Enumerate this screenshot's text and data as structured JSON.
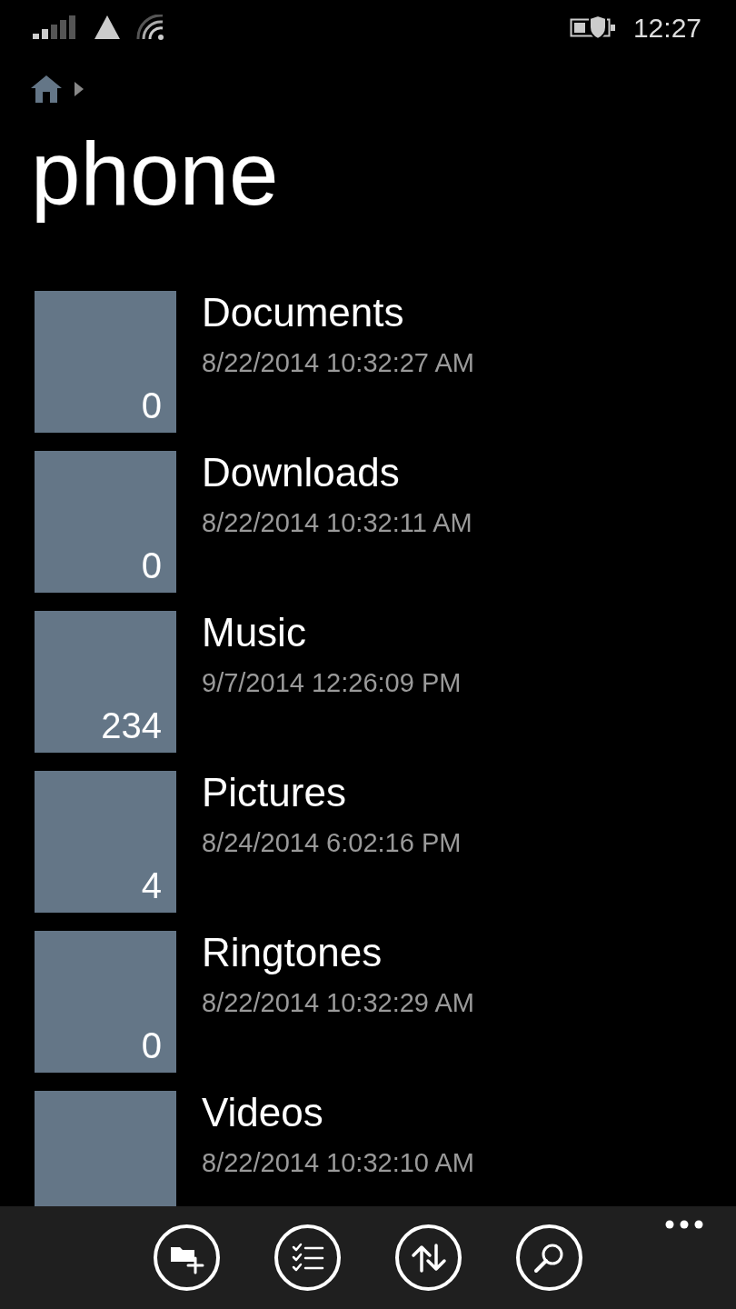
{
  "status_bar": {
    "time": "12:27"
  },
  "page": {
    "title": "phone"
  },
  "folders": [
    {
      "name": "Documents",
      "modified": "8/22/2014 10:32:27 AM",
      "count": "0"
    },
    {
      "name": "Downloads",
      "modified": "8/22/2014 10:32:11 AM",
      "count": "0"
    },
    {
      "name": "Music",
      "modified": "9/7/2014 12:26:09 PM",
      "count": "234"
    },
    {
      "name": "Pictures",
      "modified": "8/24/2014 6:02:16 PM",
      "count": "4"
    },
    {
      "name": "Ringtones",
      "modified": "8/22/2014 10:32:29 AM",
      "count": "0"
    },
    {
      "name": "Videos",
      "modified": "8/22/2014 10:32:10 AM"
    }
  ],
  "app_bar": {
    "buttons": [
      {
        "kind": "new-folder"
      },
      {
        "kind": "select"
      },
      {
        "kind": "sort"
      },
      {
        "kind": "search"
      }
    ]
  }
}
